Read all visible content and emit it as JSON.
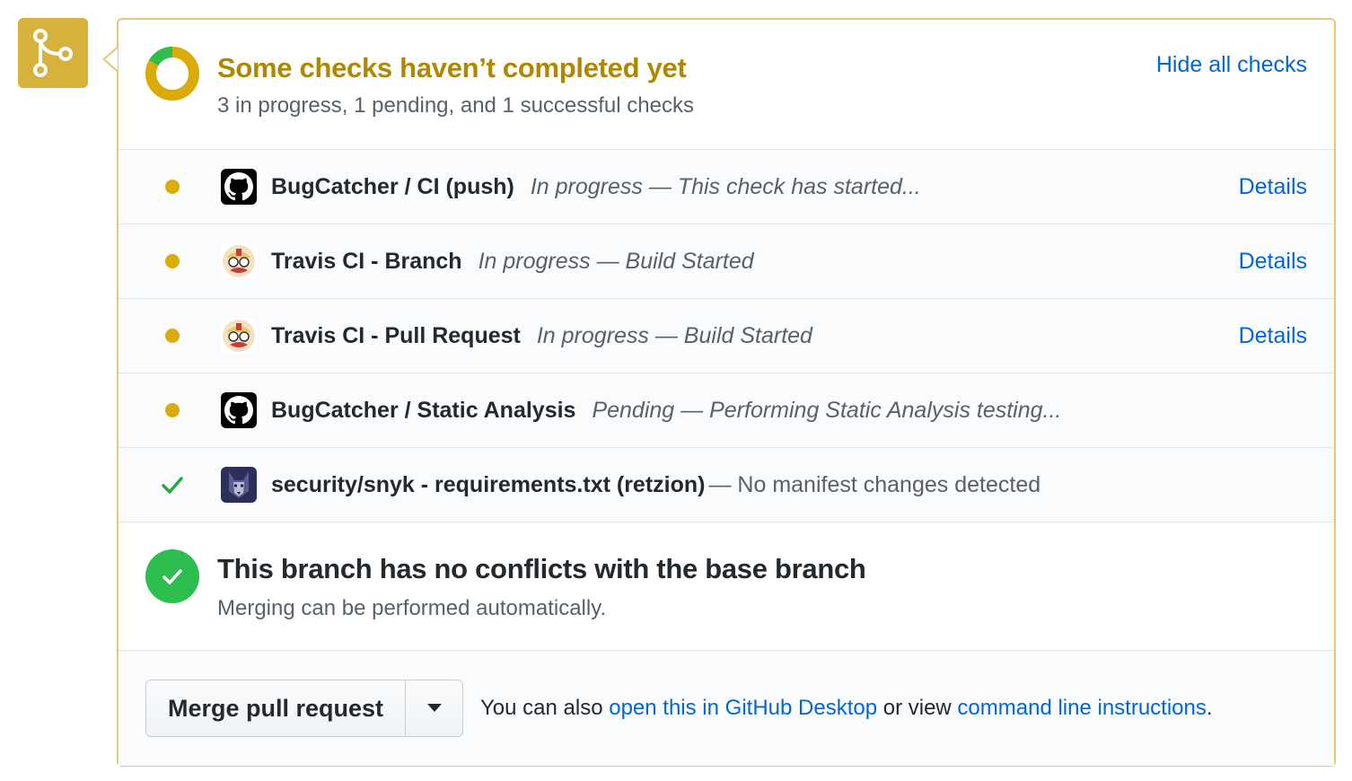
{
  "colors": {
    "pending": "#dbab09",
    "success": "#2cbe4e",
    "link": "#0366d6",
    "header_title": "#b08800",
    "badge": "#d6b13c"
  },
  "header": {
    "title": "Some checks haven’t completed yet",
    "subtitle": "3 in progress, 1 pending, and 1 successful checks",
    "toggle_label": "Hide all checks"
  },
  "checks": [
    {
      "status": "in-progress",
      "icon": "github-icon",
      "name": "BugCatcher / CI (push)",
      "description": "In progress — This check has started...",
      "details_label": "Details"
    },
    {
      "status": "in-progress",
      "icon": "travis-ci-icon",
      "name": "Travis CI - Branch",
      "description": "In progress — Build Started",
      "details_label": "Details"
    },
    {
      "status": "in-progress",
      "icon": "travis-ci-icon",
      "name": "Travis CI - Pull Request",
      "description": "In progress — Build Started",
      "details_label": "Details"
    },
    {
      "status": "pending",
      "icon": "github-icon",
      "name": "BugCatcher / Static Analysis",
      "description": "Pending — Performing Static Analysis testing..."
    },
    {
      "status": "success",
      "icon": "snyk-icon",
      "name": "security/snyk - requirements.txt (retzion)",
      "description": "— No manifest changes detected"
    }
  ],
  "conflicts": {
    "title": "This branch has no conflicts with the base branch",
    "subtitle": "Merging can be performed automatically."
  },
  "merge": {
    "button_label": "Merge pull request",
    "note_prefix": "You can also ",
    "desktop_link": "open this in GitHub Desktop",
    "note_middle": " or view ",
    "cli_link": "command line instructions",
    "note_suffix": "."
  }
}
